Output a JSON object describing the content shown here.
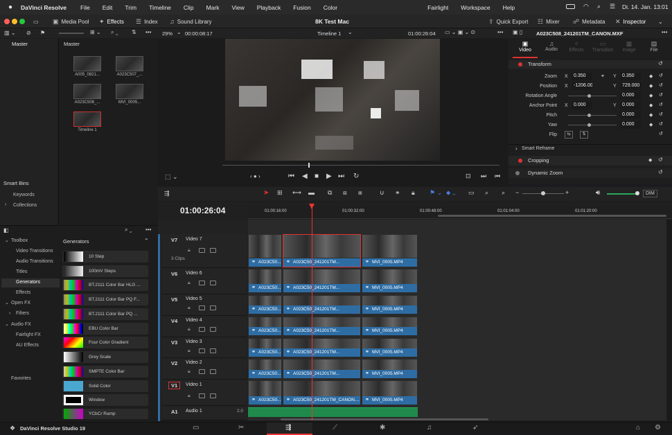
{
  "menubar": {
    "app": "DaVinci Resolve",
    "items": [
      "File",
      "Edit",
      "Trim",
      "Timeline",
      "Clip",
      "Mark",
      "View",
      "Playback",
      "Fusion",
      "Color",
      "Fairlight",
      "Workspace",
      "Help"
    ],
    "clock": "Di. 14. Jan.  13:01"
  },
  "titlebar": {
    "media_pool": "Media Pool",
    "effects": "Effects",
    "index": "Index",
    "sound_library": "Sound Library",
    "project": "8K Test Mac",
    "quick_export": "Quick Export",
    "mixer": "Mixer",
    "metadata": "Metadata",
    "inspector": "Inspector"
  },
  "viewer_bar": {
    "zoom": "29%",
    "timecode_left": "00:00:08:17",
    "timeline_name": "Timeline 1",
    "timecode_right": "01:00:26:04",
    "clip_name": "A023C508_241201TM_CANON.MXF"
  },
  "media_pool": {
    "bin": "Master",
    "sidebar_master": "Master",
    "items": [
      {
        "label": "A005_0821..."
      },
      {
        "label": "A023C507_..."
      },
      {
        "label": "A023C508_..."
      },
      {
        "label": "MVI_0005..."
      },
      {
        "label": "Timeline 1"
      }
    ],
    "smart_bins": "Smart Bins",
    "keywords": "Keywords",
    "collections": "Collections"
  },
  "effects": {
    "toolbox": "Toolbox",
    "video_transitions": "Video Transitions",
    "audio_transitions": "Audio Transitions",
    "titles": "Titles",
    "generators": "Generators",
    "effects": "Effects",
    "open_fx": "Open FX",
    "filters": "Filters",
    "audio_fx": "Audio FX",
    "fairlight_fx": "Fairlight FX",
    "au_effects": "AU Effects",
    "favorites": "Favorites",
    "generators_header": "Generators",
    "generator_items": [
      "10 Step",
      "100mV Steps",
      "BT.2111 Color Bar HLG ...",
      "BT.2111 Color Bar PQ F...",
      "BT.2111 Color Bar PQ ...",
      "EBU Color Bar",
      "Four Color Gradient",
      "Grey Scale",
      "SMPTE Color Bar",
      "Solid Color",
      "Window",
      "YCbCr Ramp"
    ]
  },
  "inspector": {
    "tabs": [
      "Video",
      "Audio",
      "Effects",
      "Transition",
      "Image",
      "File"
    ],
    "transform": "Transform",
    "zoom": "Zoom",
    "zoom_x": "0.350",
    "zoom_y": "0.350",
    "position": "Position",
    "pos_x": "-1206.000",
    "pos_y": "729.000",
    "rotation": "Rotation Angle",
    "rotation_val": "0.000",
    "anchor": "Anchor Point",
    "anchor_x": "0.000",
    "anchor_y": "0.000",
    "pitch": "Pitch",
    "pitch_val": "0.000",
    "yaw": "Yaw",
    "yaw_val": "0.000",
    "flip": "Flip",
    "smart_reframe": "Smart Reframe",
    "cropping": "Cropping",
    "dynamic_zoom": "Dynamic Zoom",
    "x": "X",
    "y": "Y"
  },
  "timeline": {
    "timecode": "01:00:26:04",
    "ruler": [
      "01:00:16:00",
      "01:00:32:00",
      "01:00:48:00",
      "01:01:04:00",
      "01:01:20:00"
    ],
    "dim": "DIM",
    "clips_count": "3 Clips",
    "tracks": [
      {
        "id": "V7",
        "name": "Video 7"
      },
      {
        "id": "V6",
        "name": "Video 6"
      },
      {
        "id": "V5",
        "name": "Video 5"
      },
      {
        "id": "V4",
        "name": "Video 4"
      },
      {
        "id": "V3",
        "name": "Video 3"
      },
      {
        "id": "V2",
        "name": "Video 2"
      },
      {
        "id": "V1",
        "name": "Video 1"
      },
      {
        "id": "A1",
        "name": "Audio 1",
        "level": "2.0"
      }
    ],
    "clip_a": "A023C50...",
    "clip_b": "A023C50_241201TM...",
    "clip_b_v1": "A023C50_241201TM_CANON....",
    "clip_c": "MVI_0005.MP4"
  },
  "footer": {
    "label": "DaVinci Resolve Studio 19"
  }
}
